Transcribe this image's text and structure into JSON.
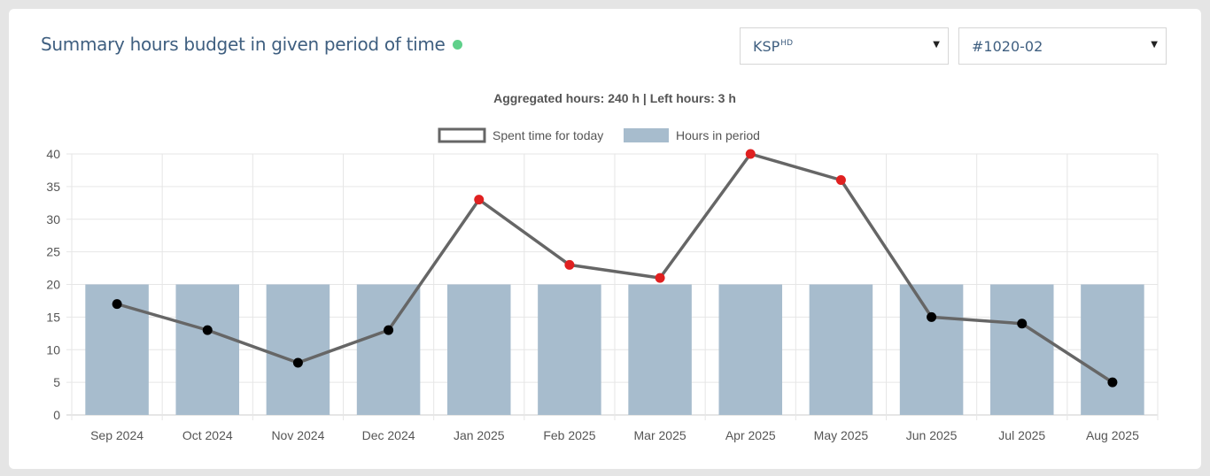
{
  "panel": {
    "title": "Summary hours budget in given period of time",
    "status_color": "#5fd08a"
  },
  "filters": {
    "client": {
      "value": "KSP",
      "sup": "HD"
    },
    "project": {
      "value": "#1020-02"
    }
  },
  "chart_data": {
    "type": "bar",
    "title": "Aggregated hours: 240 h | Left hours: 3 h",
    "categories": [
      "Sep 2024",
      "Oct 2024",
      "Nov 2024",
      "Dec 2024",
      "Jan 2025",
      "Feb 2025",
      "Mar 2025",
      "Apr 2025",
      "May 2025",
      "Jun 2025",
      "Jul 2025",
      "Aug 2025"
    ],
    "series": [
      {
        "name": "Spent time for today",
        "type": "line",
        "color": "#666666",
        "values": [
          17,
          13,
          8,
          13,
          33,
          23,
          21,
          40,
          36,
          15,
          14,
          5
        ]
      },
      {
        "name": "Hours in period",
        "type": "bar",
        "color": "#a7bccd",
        "values": [
          20,
          20,
          20,
          20,
          20,
          20,
          20,
          20,
          20,
          20,
          20,
          20
        ]
      }
    ],
    "ylim": [
      0,
      40
    ],
    "yticks": [
      0,
      5,
      10,
      15,
      20,
      25,
      30,
      35,
      40
    ],
    "over_budget_color": "#e02020",
    "under_budget_color": "#000000",
    "grid": true,
    "legend": "top-center"
  }
}
